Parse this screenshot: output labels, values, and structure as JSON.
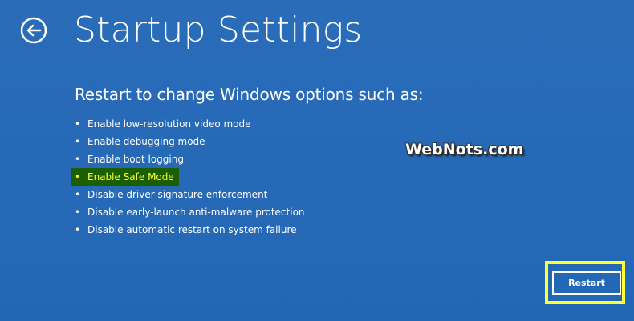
{
  "header": {
    "back_icon": "back-arrow-circle-icon",
    "title": "Startup Settings"
  },
  "main": {
    "subtitle": "Restart to change Windows options such as:",
    "bullet": "•",
    "options": [
      {
        "label": "Enable low-resolution video mode",
        "highlighted": false
      },
      {
        "label": "Enable debugging mode",
        "highlighted": false
      },
      {
        "label": "Enable boot logging",
        "highlighted": false
      },
      {
        "label": "Enable Safe Mode",
        "highlighted": true
      },
      {
        "label": "Disable driver signature enforcement",
        "highlighted": false
      },
      {
        "label": "Disable early-launch anti-malware protection",
        "highlighted": false
      },
      {
        "label": "Disable automatic restart on system failure",
        "highlighted": false
      }
    ]
  },
  "watermark": {
    "text": "WebNots.com"
  },
  "footer": {
    "restart_label": "Restart"
  },
  "colors": {
    "background": "#2469b7",
    "text": "#ffffff",
    "highlight_text": "#ffff33",
    "highlight_background": "#1c5f00",
    "annotation_border": "#ffff33"
  }
}
